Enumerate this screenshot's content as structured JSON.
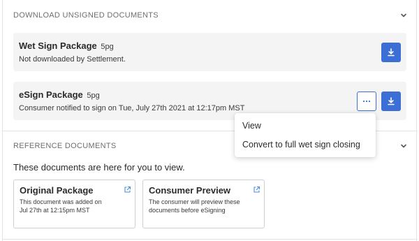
{
  "download_section": {
    "header": "DOWNLOAD UNSIGNED DOCUMENTS",
    "packages": [
      {
        "title": "Wet Sign Package",
        "pages": "5pg",
        "status": "Not downloaded by Settlement."
      },
      {
        "title": "eSign Package",
        "pages": "5pg",
        "status": "Consumer notified to sign on Tue, July 27th 2021 at 12:17pm MST"
      }
    ]
  },
  "context_menu": {
    "items": [
      "View",
      "Convert to full wet sign closing"
    ]
  },
  "reference_section": {
    "header": "REFERENCE DOCUMENTS",
    "intro": "These documents are here for you to view.",
    "documents": [
      {
        "title": "Original Package",
        "desc_line1": "This document was added on",
        "desc_line2": "Jul 27th at 12:15pm MST"
      },
      {
        "title": "Consumer Preview",
        "desc_line1": "The consumer will preview these",
        "desc_line2": "documents before eSigning"
      }
    ]
  },
  "icons": {
    "download": "download-icon",
    "more": "ellipsis-icon",
    "external_link": "external-link-icon",
    "chevron": "chevron-down-icon"
  },
  "colors": {
    "accent": "#3b6fd6",
    "card_bg": "#f4f4f4",
    "link_icon": "#4a90d9"
  }
}
